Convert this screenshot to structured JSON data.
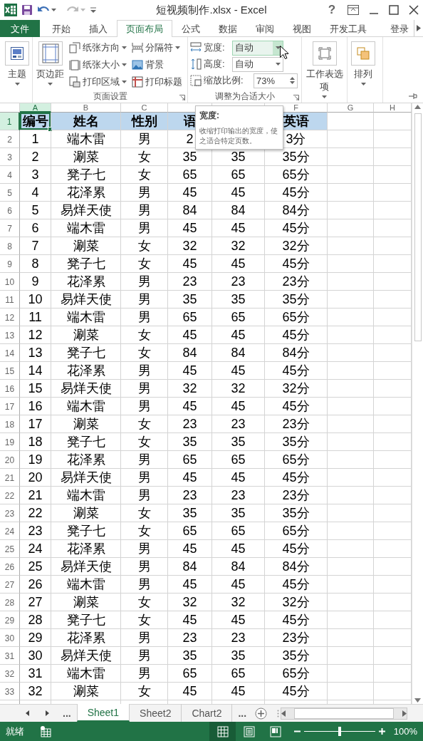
{
  "title_bar": {
    "title": "短视频制作.xlsx - Excel",
    "help_button": "?"
  },
  "ribbon_tabs": [
    {
      "label": "文件",
      "kind": "file",
      "selected": false
    },
    {
      "label": "开始",
      "kind": "tab",
      "selected": false
    },
    {
      "label": "插入",
      "kind": "tab",
      "selected": false
    },
    {
      "label": "页面布局",
      "kind": "tab",
      "selected": true
    },
    {
      "label": "公式",
      "kind": "tab",
      "selected": false
    },
    {
      "label": "数据",
      "kind": "tab",
      "selected": false
    },
    {
      "label": "审阅",
      "kind": "tab",
      "selected": false
    },
    {
      "label": "视图",
      "kind": "tab",
      "selected": false
    },
    {
      "label": "开发工具",
      "kind": "tab",
      "selected": false
    },
    {
      "label": "登录",
      "kind": "account",
      "selected": false
    }
  ],
  "ribbon": {
    "themes_button": {
      "label": "主题"
    },
    "page_setup": {
      "label": "页面设置",
      "margins_button": "页边距",
      "commands": [
        {
          "label": "纸张方向",
          "kind": "orientation",
          "dropdown": true
        },
        {
          "label": "纸张大小",
          "kind": "size",
          "dropdown": true
        },
        {
          "label": "打印区域",
          "kind": "print_area",
          "dropdown": true
        },
        {
          "label": "分隔符",
          "kind": "breaks",
          "dropdown": true
        },
        {
          "label": "背景",
          "kind": "background",
          "dropdown": false
        },
        {
          "label": "打印标题",
          "kind": "print_titles",
          "dropdown": false
        }
      ]
    },
    "scale_to_fit": {
      "label": "调整为合适大小",
      "fields": [
        {
          "label": "宽度:",
          "value": "自动",
          "kind": "width",
          "hovered": true
        },
        {
          "label": "高度:",
          "value": "自动",
          "kind": "height",
          "hovered": false
        },
        {
          "label": "缩放比例:",
          "value": "73%",
          "kind": "scale",
          "hovered": false
        }
      ]
    },
    "sheet_options_button": {
      "label": "工作表选项"
    },
    "arrange_button": {
      "label": "排列"
    }
  },
  "tooltip": {
    "title": "宽度:",
    "text": "收缩打印输出的宽度，使之适合特定页数。"
  },
  "sheet": {
    "columns": [
      {
        "label": "A",
        "selected": true
      },
      {
        "label": "B",
        "selected": false
      },
      {
        "label": "C",
        "selected": false
      },
      {
        "selected": false
      },
      {
        "selected": false
      },
      {
        "label": "F",
        "selected": false
      },
      {
        "label": "G",
        "selected": false
      },
      {
        "label": "H",
        "selected": false
      }
    ],
    "rows": [
      {
        "number": "1",
        "kind": "header",
        "selected": true,
        "cells": [
          "编号",
          "姓名",
          "性别",
          "语",
          null,
          "英语"
        ]
      },
      {
        "number": "2",
        "kind": "data",
        "selected": false,
        "cells": [
          "1",
          "端木雷",
          "男",
          "2",
          null,
          "3分"
        ]
      },
      {
        "number": "3",
        "kind": "data",
        "selected": false,
        "cells": [
          "2",
          "涮菜",
          "女",
          "35",
          "35",
          "35分"
        ]
      },
      {
        "number": "4",
        "kind": "data",
        "selected": false,
        "cells": [
          "3",
          "凳子七",
          "女",
          "65",
          "65",
          "65分"
        ]
      },
      {
        "number": "5",
        "kind": "data",
        "selected": false,
        "cells": [
          "4",
          "花泽累",
          "男",
          "45",
          "45",
          "45分"
        ]
      },
      {
        "number": "6",
        "kind": "data",
        "selected": false,
        "cells": [
          "5",
          "易烊天使",
          "男",
          "84",
          "84",
          "84分"
        ]
      },
      {
        "number": "7",
        "kind": "data",
        "selected": false,
        "cells": [
          "6",
          "端木雷",
          "男",
          "45",
          "45",
          "45分"
        ]
      },
      {
        "number": "8",
        "kind": "data",
        "selected": false,
        "cells": [
          "7",
          "涮菜",
          "女",
          "32",
          "32",
          "32分"
        ]
      },
      {
        "number": "9",
        "kind": "data",
        "selected": false,
        "cells": [
          "8",
          "凳子七",
          "女",
          "45",
          "45",
          "45分"
        ]
      },
      {
        "number": "10",
        "kind": "data",
        "selected": false,
        "cells": [
          "9",
          "花泽累",
          "男",
          "23",
          "23",
          "23分"
        ]
      },
      {
        "number": "11",
        "kind": "data",
        "selected": false,
        "cells": [
          "10",
          "易烊天使",
          "男",
          "35",
          "35",
          "35分"
        ]
      },
      {
        "number": "12",
        "kind": "data",
        "selected": false,
        "cells": [
          "11",
          "端木雷",
          "男",
          "65",
          "65",
          "65分"
        ]
      },
      {
        "number": "13",
        "kind": "data",
        "selected": false,
        "cells": [
          "12",
          "涮菜",
          "女",
          "45",
          "45",
          "45分"
        ]
      },
      {
        "number": "14",
        "kind": "data",
        "selected": false,
        "cells": [
          "13",
          "凳子七",
          "女",
          "84",
          "84",
          "84分"
        ]
      },
      {
        "number": "15",
        "kind": "data",
        "selected": false,
        "cells": [
          "14",
          "花泽累",
          "男",
          "45",
          "45",
          "45分"
        ]
      },
      {
        "number": "16",
        "kind": "data",
        "selected": false,
        "cells": [
          "15",
          "易烊天使",
          "男",
          "32",
          "32",
          "32分"
        ]
      },
      {
        "number": "17",
        "kind": "data",
        "selected": false,
        "cells": [
          "16",
          "端木雷",
          "男",
          "45",
          "45",
          "45分"
        ]
      },
      {
        "number": "18",
        "kind": "data",
        "selected": false,
        "cells": [
          "17",
          "涮菜",
          "女",
          "23",
          "23",
          "23分"
        ]
      },
      {
        "number": "19",
        "kind": "data",
        "selected": false,
        "cells": [
          "18",
          "凳子七",
          "女",
          "35",
          "35",
          "35分"
        ]
      },
      {
        "number": "20",
        "kind": "data",
        "selected": false,
        "cells": [
          "19",
          "花泽累",
          "男",
          "65",
          "65",
          "65分"
        ]
      },
      {
        "number": "21",
        "kind": "data",
        "selected": false,
        "cells": [
          "20",
          "易烊天使",
          "男",
          "45",
          "45",
          "45分"
        ]
      },
      {
        "number": "22",
        "kind": "data",
        "selected": false,
        "cells": [
          "21",
          "端木雷",
          "男",
          "23",
          "23",
          "23分"
        ]
      },
      {
        "number": "23",
        "kind": "data",
        "selected": false,
        "cells": [
          "22",
          "涮菜",
          "女",
          "35",
          "35",
          "35分"
        ]
      },
      {
        "number": "24",
        "kind": "data",
        "selected": false,
        "cells": [
          "23",
          "凳子七",
          "女",
          "65",
          "65",
          "65分"
        ]
      },
      {
        "number": "25",
        "kind": "data",
        "selected": false,
        "cells": [
          "24",
          "花泽累",
          "男",
          "45",
          "45",
          "45分"
        ]
      },
      {
        "number": "26",
        "kind": "data",
        "selected": false,
        "cells": [
          "25",
          "易烊天使",
          "男",
          "84",
          "84",
          "84分"
        ]
      },
      {
        "number": "27",
        "kind": "data",
        "selected": false,
        "cells": [
          "26",
          "端木雷",
          "男",
          "45",
          "45",
          "45分"
        ]
      },
      {
        "number": "28",
        "kind": "data",
        "selected": false,
        "cells": [
          "27",
          "涮菜",
          "女",
          "32",
          "32",
          "32分"
        ]
      },
      {
        "number": "29",
        "kind": "data",
        "selected": false,
        "cells": [
          "28",
          "凳子七",
          "女",
          "45",
          "45",
          "45分"
        ]
      },
      {
        "number": "30",
        "kind": "data",
        "selected": false,
        "cells": [
          "29",
          "花泽累",
          "男",
          "23",
          "23",
          "23分"
        ]
      },
      {
        "number": "31",
        "kind": "data",
        "selected": false,
        "cells": [
          "30",
          "易烊天使",
          "男",
          "35",
          "35",
          "35分"
        ]
      },
      {
        "number": "32",
        "kind": "data",
        "selected": false,
        "cells": [
          "31",
          "端木雷",
          "男",
          "65",
          "65",
          "65分"
        ]
      },
      {
        "number": "33",
        "kind": "data",
        "selected": false,
        "cells": [
          "32",
          "涮菜",
          "女",
          "45",
          "45",
          "45分"
        ]
      }
    ]
  },
  "sheet_tabs": {
    "overflow_left": "...",
    "overflow_right": "...",
    "tabs": [
      {
        "label": "Sheet1",
        "selected": true
      },
      {
        "label": "Sheet2",
        "selected": false
      },
      {
        "label": "Chart2",
        "selected": false
      }
    ]
  },
  "status_bar": {
    "status": "就绪",
    "views": [
      {
        "kind": "normal",
        "selected": true
      },
      {
        "kind": "page_layout",
        "selected": false
      },
      {
        "kind": "page_break",
        "selected": false
      }
    ],
    "zoom": {
      "level": 0.5,
      "reading": "100%"
    }
  }
}
